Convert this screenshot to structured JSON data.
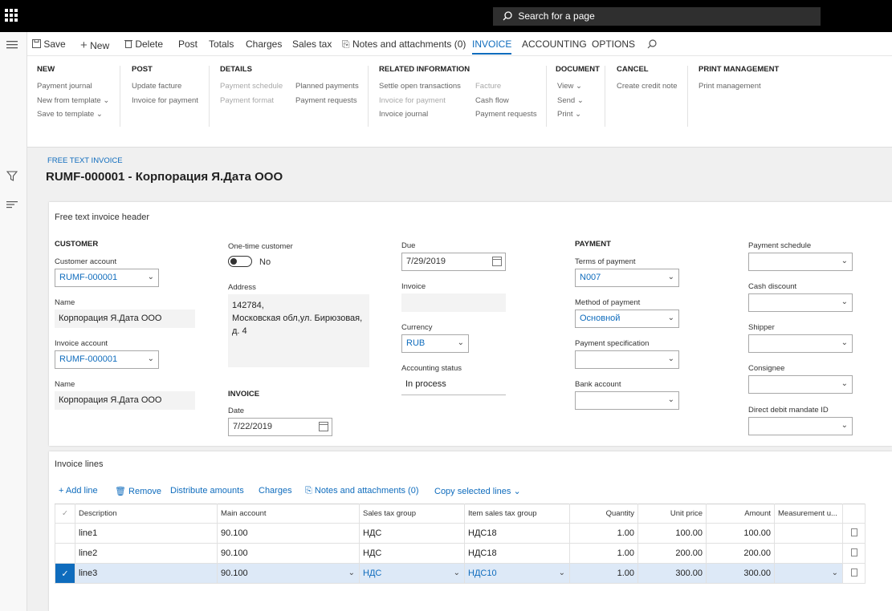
{
  "topbar": {
    "search_placeholder": "Search for a page"
  },
  "action_bar": {
    "save": "Save",
    "new": "New",
    "delete": "Delete",
    "post": "Post",
    "totals": "Totals",
    "charges": "Charges",
    "sales_tax": "Sales tax",
    "notes": "Notes and attachments (0)",
    "tab_invoice": "INVOICE",
    "tab_accounting": "ACCOUNTING",
    "tab_options": "OPTIONS"
  },
  "ribbon": {
    "new": {
      "title": "NEW",
      "items": [
        "Payment journal",
        "New from template ⌄",
        "Save to template ⌄"
      ]
    },
    "post": {
      "title": "POST",
      "items": [
        "Update facture",
        "Invoice for payment"
      ]
    },
    "details": {
      "title": "DETAILS",
      "items": [
        "Payment schedule",
        "Payment format",
        "Planned payments",
        "Payment requests"
      ]
    },
    "related": {
      "title": "RELATED INFORMATION",
      "items": [
        "Settle open transactions",
        "Invoice for payment",
        "Invoice journal",
        "Facture",
        "Cash flow",
        "Payment requests"
      ]
    },
    "document": {
      "title": "DOCUMENT",
      "items": [
        "View ⌄",
        "Send ⌄",
        "Print ⌄"
      ]
    },
    "cancel": {
      "title": "CANCEL",
      "items": [
        "Create credit note"
      ]
    },
    "print_mgmt": {
      "title": "PRINT MANAGEMENT",
      "items": [
        "Print management"
      ]
    }
  },
  "page": {
    "breadcrumb": "FREE TEXT INVOICE",
    "title": "RUMF-000001 - Корпорация Я.Дата ООО"
  },
  "header": {
    "title": "Free text invoice header",
    "customer": {
      "section": "CUSTOMER",
      "customer_account_label": "Customer account",
      "customer_account": "RUMF-000001",
      "name_label": "Name",
      "name": "Корпорация Я.Дата ООО",
      "invoice_account_label": "Invoice account",
      "invoice_account": "RUMF-000001",
      "name2_label": "Name",
      "name2": "Корпорация Я.Дата ООО"
    },
    "onetime": {
      "label": "One-time customer",
      "value": "No"
    },
    "address": {
      "label": "Address",
      "line1": "142784,",
      "line2": "Московская обл,ул. Бирюзовая,",
      "line3": "д. 4"
    },
    "invoice_section": {
      "section": "INVOICE",
      "date_label": "Date",
      "date": "7/22/2019"
    },
    "due": {
      "label": "Due",
      "value": "7/29/2019"
    },
    "invoice": {
      "label": "Invoice",
      "value": ""
    },
    "currency": {
      "label": "Currency",
      "value": "RUB"
    },
    "accounting_status": {
      "label": "Accounting status",
      "value": "In process"
    },
    "payment": {
      "section": "PAYMENT",
      "terms_label": "Terms of payment",
      "terms": "N007",
      "method_label": "Method of payment",
      "method": "Основной",
      "spec_label": "Payment specification",
      "spec": "",
      "bank_label": "Bank account",
      "bank": ""
    },
    "right": {
      "schedule_label": "Payment schedule",
      "cash_discount_label": "Cash discount",
      "shipper_label": "Shipper",
      "consignee_label": "Consignee",
      "direct_debit_label": "Direct debit mandate ID"
    }
  },
  "lines": {
    "title": "Invoice lines",
    "toolbar": {
      "add": "Add line",
      "remove": "Remove",
      "distribute": "Distribute amounts",
      "charges": "Charges",
      "notes": "Notes and attachments (0)",
      "copy": "Copy selected lines ⌄"
    },
    "columns": [
      "Description",
      "Main account",
      "Sales tax group",
      "Item sales tax group",
      "Quantity",
      "Unit price",
      "Amount",
      "Measurement u..."
    ],
    "rows": [
      {
        "description": "line1",
        "main_account": "90.100",
        "sales_tax_group": "НДС",
        "item_sales_tax_group": "НДС18",
        "quantity": "1.00",
        "unit_price": "100.00",
        "amount": "100.00"
      },
      {
        "description": "line2",
        "main_account": "90.100",
        "sales_tax_group": "НДС",
        "item_sales_tax_group": "НДС18",
        "quantity": "1.00",
        "unit_price": "200.00",
        "amount": "200.00"
      },
      {
        "description": "line3",
        "main_account": "90.100",
        "sales_tax_group": "НДС",
        "item_sales_tax_group": "НДС10",
        "quantity": "1.00",
        "unit_price": "300.00",
        "amount": "300.00"
      }
    ]
  },
  "colors": {
    "accent": "#0f6cbd",
    "topbar": "#000000",
    "selected_row": "#dde9f7"
  }
}
